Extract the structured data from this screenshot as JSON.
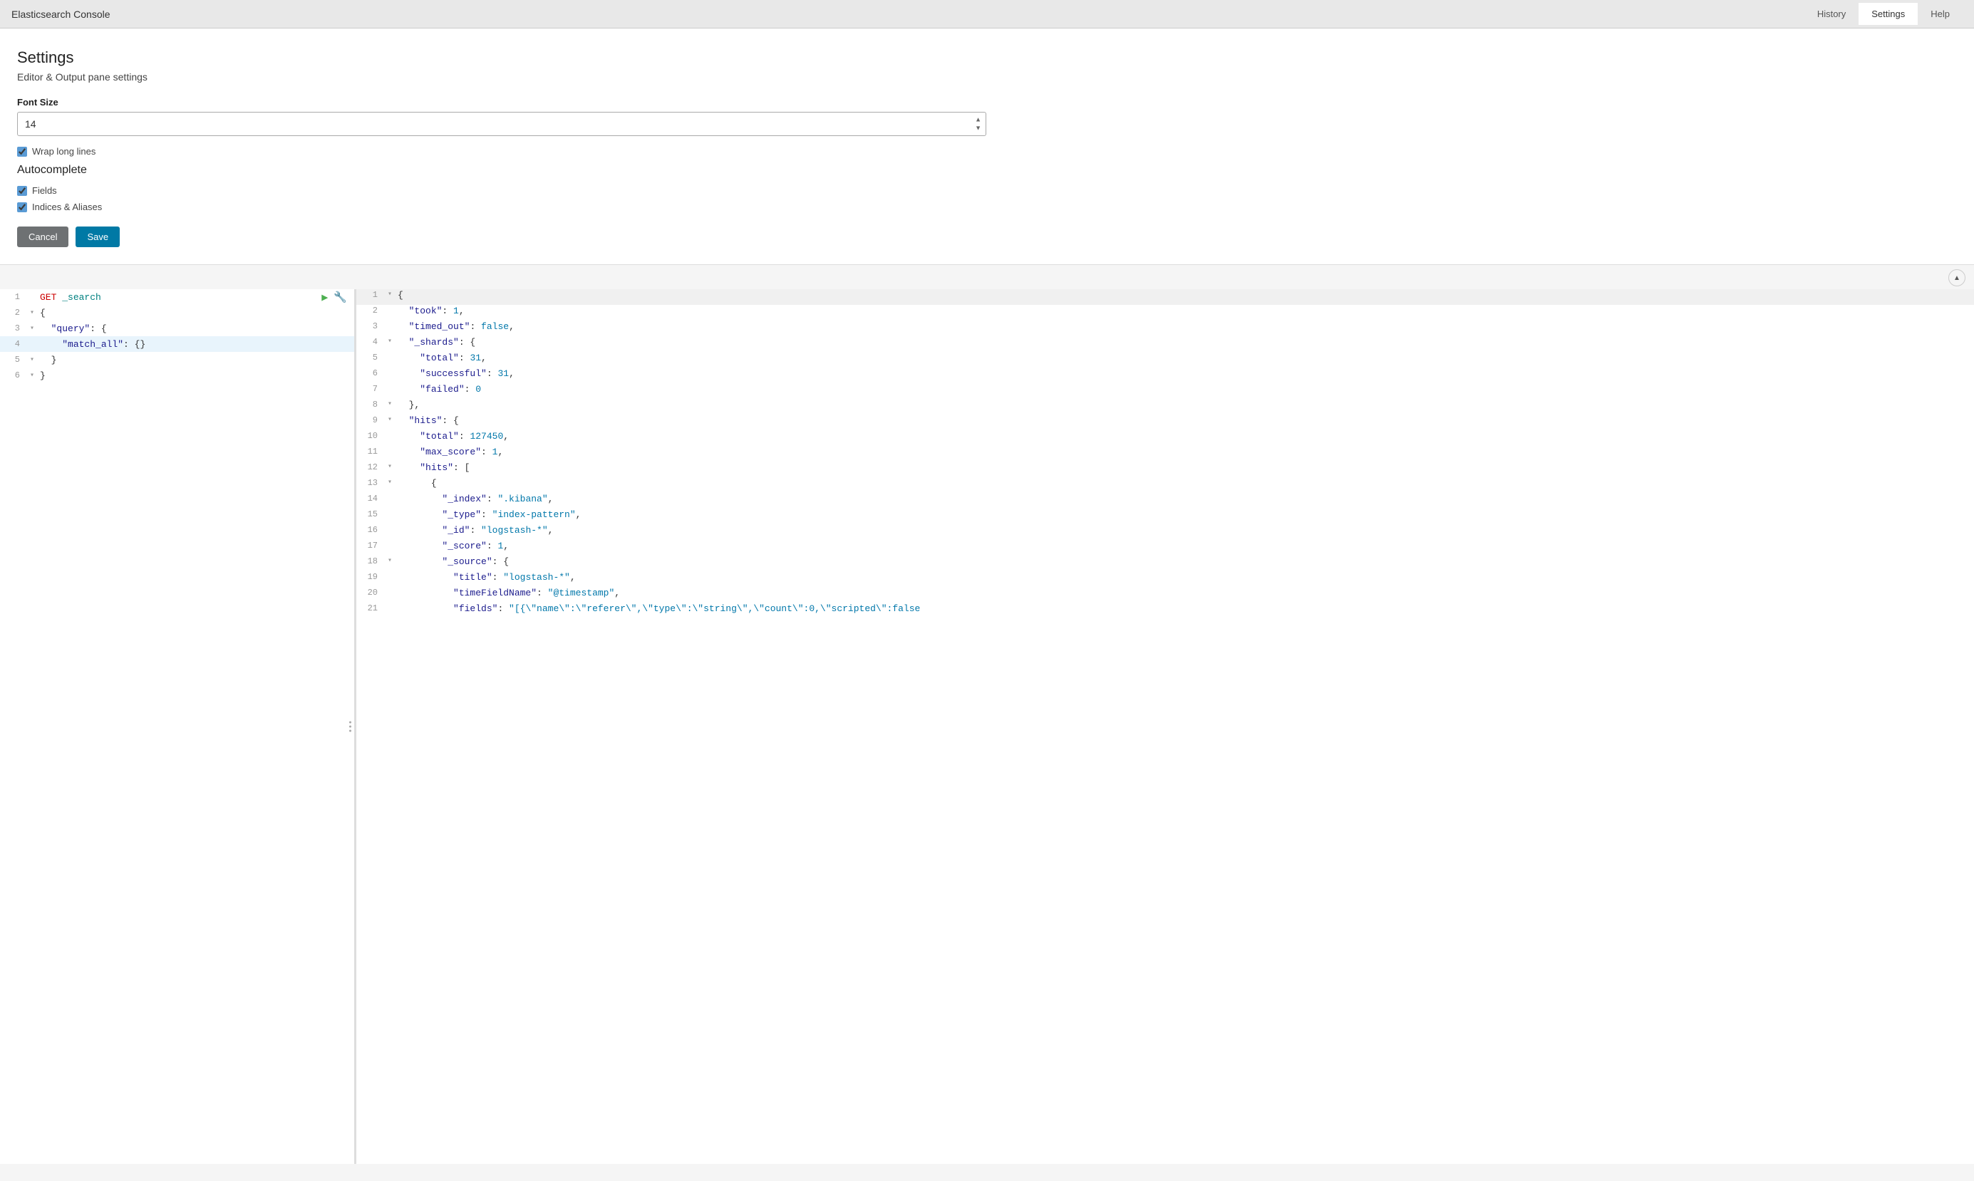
{
  "topbar": {
    "title": "Elasticsearch Console",
    "nav": [
      {
        "id": "history",
        "label": "History",
        "active": false
      },
      {
        "id": "settings",
        "label": "Settings",
        "active": true
      },
      {
        "id": "help",
        "label": "Help",
        "active": false
      }
    ]
  },
  "settings": {
    "title": "Settings",
    "subtitle": "Editor & Output pane settings",
    "font_size_label": "Font Size",
    "font_size_value": "14",
    "wrap_long_lines_label": "Wrap long lines",
    "wrap_long_lines_checked": true,
    "autocomplete_title": "Autocomplete",
    "fields_label": "Fields",
    "fields_checked": true,
    "indices_aliases_label": "Indices & Aliases",
    "indices_aliases_checked": true,
    "cancel_label": "Cancel",
    "save_label": "Save"
  },
  "editor": {
    "left": {
      "lines": [
        {
          "num": "1",
          "fold": "",
          "content": "GET _search",
          "highlight": false,
          "has_actions": true
        },
        {
          "num": "2",
          "fold": "▾",
          "content": "{",
          "highlight": false,
          "has_actions": false
        },
        {
          "num": "3",
          "fold": "▾",
          "content": "  \"query\": {",
          "highlight": false,
          "has_actions": false
        },
        {
          "num": "4",
          "fold": "",
          "content": "    \"match_all\": {}",
          "highlight": true,
          "has_actions": false
        },
        {
          "num": "5",
          "fold": "▾",
          "content": "  }",
          "highlight": false,
          "has_actions": false
        },
        {
          "num": "6",
          "fold": "▾",
          "content": "}",
          "highlight": false,
          "has_actions": false
        }
      ]
    },
    "right": {
      "lines": [
        {
          "num": "1",
          "fold": "▾",
          "content": "{",
          "highlight": true
        },
        {
          "num": "2",
          "fold": "",
          "content": "  \"took\": 1,",
          "highlight": false
        },
        {
          "num": "3",
          "fold": "",
          "content": "  \"timed_out\": false,",
          "highlight": false
        },
        {
          "num": "4",
          "fold": "▾",
          "content": "  \"_shards\": {",
          "highlight": false
        },
        {
          "num": "5",
          "fold": "",
          "content": "    \"total\": 31,",
          "highlight": false
        },
        {
          "num": "6",
          "fold": "",
          "content": "    \"successful\": 31,",
          "highlight": false
        },
        {
          "num": "7",
          "fold": "",
          "content": "    \"failed\": 0",
          "highlight": false
        },
        {
          "num": "8",
          "fold": "▾",
          "content": "  },",
          "highlight": false
        },
        {
          "num": "9",
          "fold": "▾",
          "content": "  \"hits\": {",
          "highlight": false
        },
        {
          "num": "10",
          "fold": "",
          "content": "    \"total\": 127450,",
          "highlight": false
        },
        {
          "num": "11",
          "fold": "",
          "content": "    \"max_score\": 1,",
          "highlight": false
        },
        {
          "num": "12",
          "fold": "▾",
          "content": "    \"hits\": [",
          "highlight": false
        },
        {
          "num": "13",
          "fold": "▾",
          "content": "      {",
          "highlight": false
        },
        {
          "num": "14",
          "fold": "",
          "content": "        \"_index\": \".kibana\",",
          "highlight": false
        },
        {
          "num": "15",
          "fold": "",
          "content": "        \"_type\": \"index-pattern\",",
          "highlight": false
        },
        {
          "num": "16",
          "fold": "",
          "content": "        \"_id\": \"logstash-*\",",
          "highlight": false
        },
        {
          "num": "17",
          "fold": "",
          "content": "        \"_score\": 1,",
          "highlight": false
        },
        {
          "num": "18",
          "fold": "▾",
          "content": "        \"_source\": {",
          "highlight": false
        },
        {
          "num": "19",
          "fold": "",
          "content": "          \"title\": \"logstash-*\",",
          "highlight": false
        },
        {
          "num": "20",
          "fold": "",
          "content": "          \"timeFieldName\": \"@timestamp\",",
          "highlight": false
        },
        {
          "num": "21",
          "fold": "",
          "content": "          \"fields\": \"[{\\\"name\\\":\\\"referer\\\",\\\"type\\\":\\\"string\\\",\\\"count\\\":0,\\\"scripted\\\":false",
          "highlight": false
        }
      ]
    }
  },
  "icons": {
    "play": "▶",
    "wrench": "🔧",
    "collapse_up": "▲",
    "spinner_up": "▲",
    "spinner_down": "▼"
  }
}
